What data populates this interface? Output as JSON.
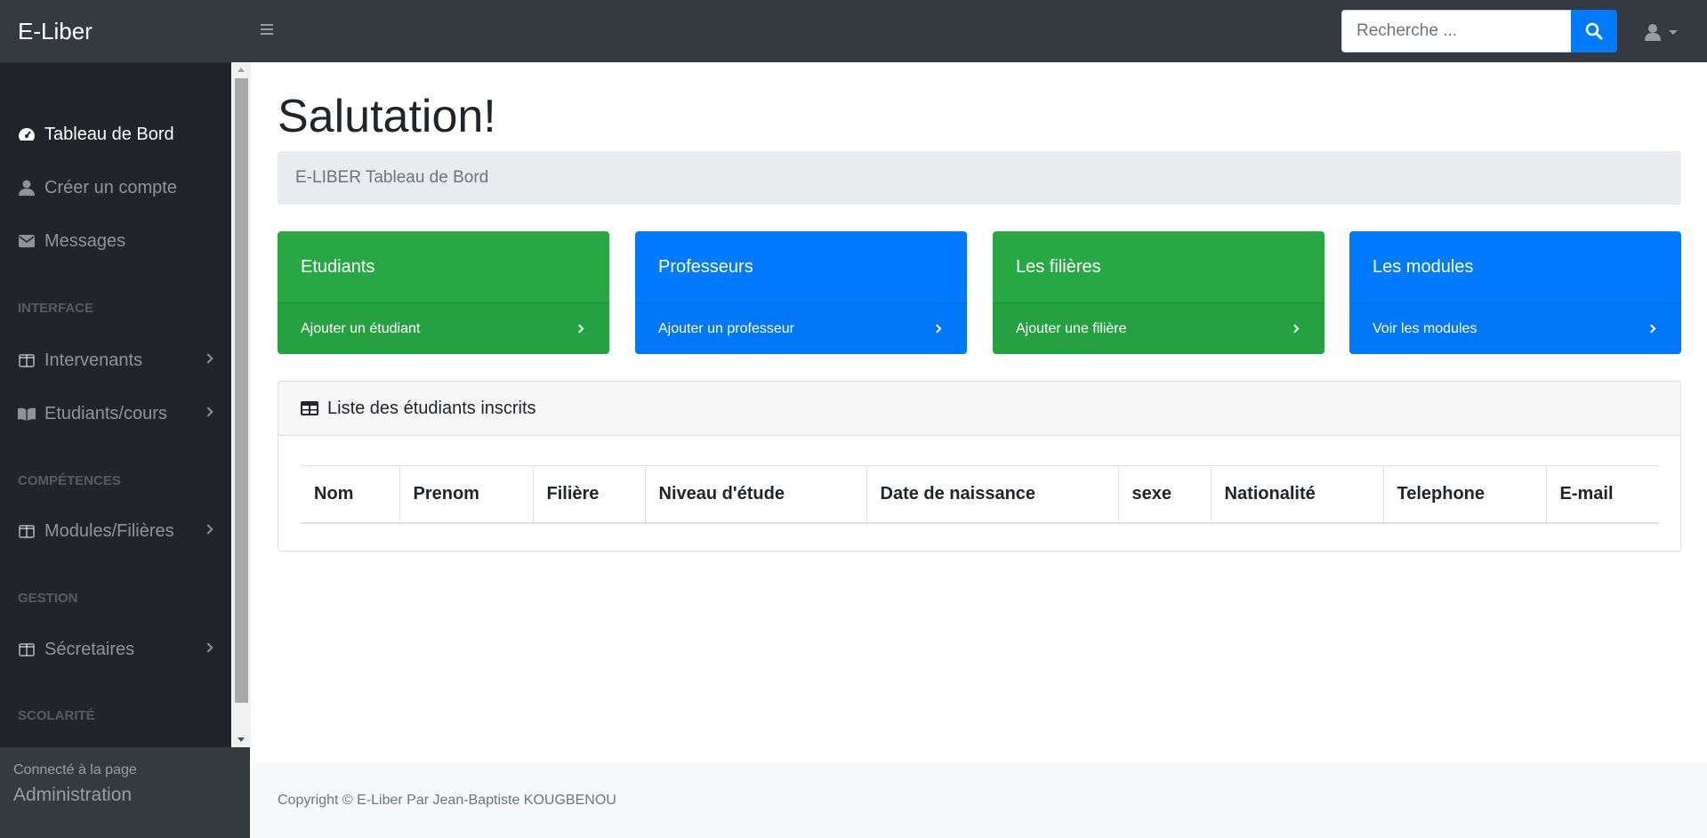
{
  "app": {
    "brand": "E-Liber"
  },
  "topbar": {
    "search_placeholder": "Recherche ...",
    "icons": {
      "menu": "bars-icon",
      "search": "search-icon",
      "user": "user-icon"
    }
  },
  "sidebar": {
    "items": [
      {
        "label": "Tableau de Bord",
        "icon": "tachometer-icon",
        "active": true
      },
      {
        "label": "Créer un compte",
        "icon": "user-icon"
      },
      {
        "label": "Messages",
        "icon": "envelope-icon"
      }
    ],
    "headings": {
      "interface": "INTERFACE",
      "competences": "COMPÉTENCES",
      "gestion": "GESTION",
      "scolarite": "SCOLARITÉ"
    },
    "interface_items": [
      {
        "label": "Intervenants",
        "icon": "columns-icon"
      },
      {
        "label": "Etudiants/cours",
        "icon": "book-open-icon"
      }
    ],
    "competences_items": [
      {
        "label": "Modules/Filières",
        "icon": "columns-icon"
      }
    ],
    "gestion_items": [
      {
        "label": "Sécretaires",
        "icon": "columns-icon"
      }
    ],
    "footer": {
      "small": "Connecté à la page",
      "big": "Administration"
    }
  },
  "main": {
    "title": "Salutation!",
    "breadcrumb": "E-LIBER Tableau de Bord",
    "cards": [
      {
        "title": "Etudiants",
        "link": "Ajouter un étudiant",
        "color": "#28a745"
      },
      {
        "title": "Professeurs",
        "link": "Ajouter un professeur",
        "color": "#007bff"
      },
      {
        "title": "Les filières",
        "link": "Ajouter une filière",
        "color": "#28a745"
      },
      {
        "title": "Les modules",
        "link": "Voir les modules",
        "color": "#007bff"
      }
    ],
    "table": {
      "title": "Liste des étudiants inscrits",
      "columns": [
        "Nom",
        "Prenom",
        "Filière",
        "Niveau d'étude",
        "Date de naissance",
        "sexe",
        "Nationalité",
        "Telephone",
        "E-mail"
      ]
    }
  },
  "footer": {
    "copyright": "Copyright © E-Liber Par Jean-Baptiste KOUGBENOU"
  },
  "colors": {
    "sidebar": "#212529",
    "topbar": "#343a40",
    "primary": "#007bff",
    "success": "#28a745"
  }
}
